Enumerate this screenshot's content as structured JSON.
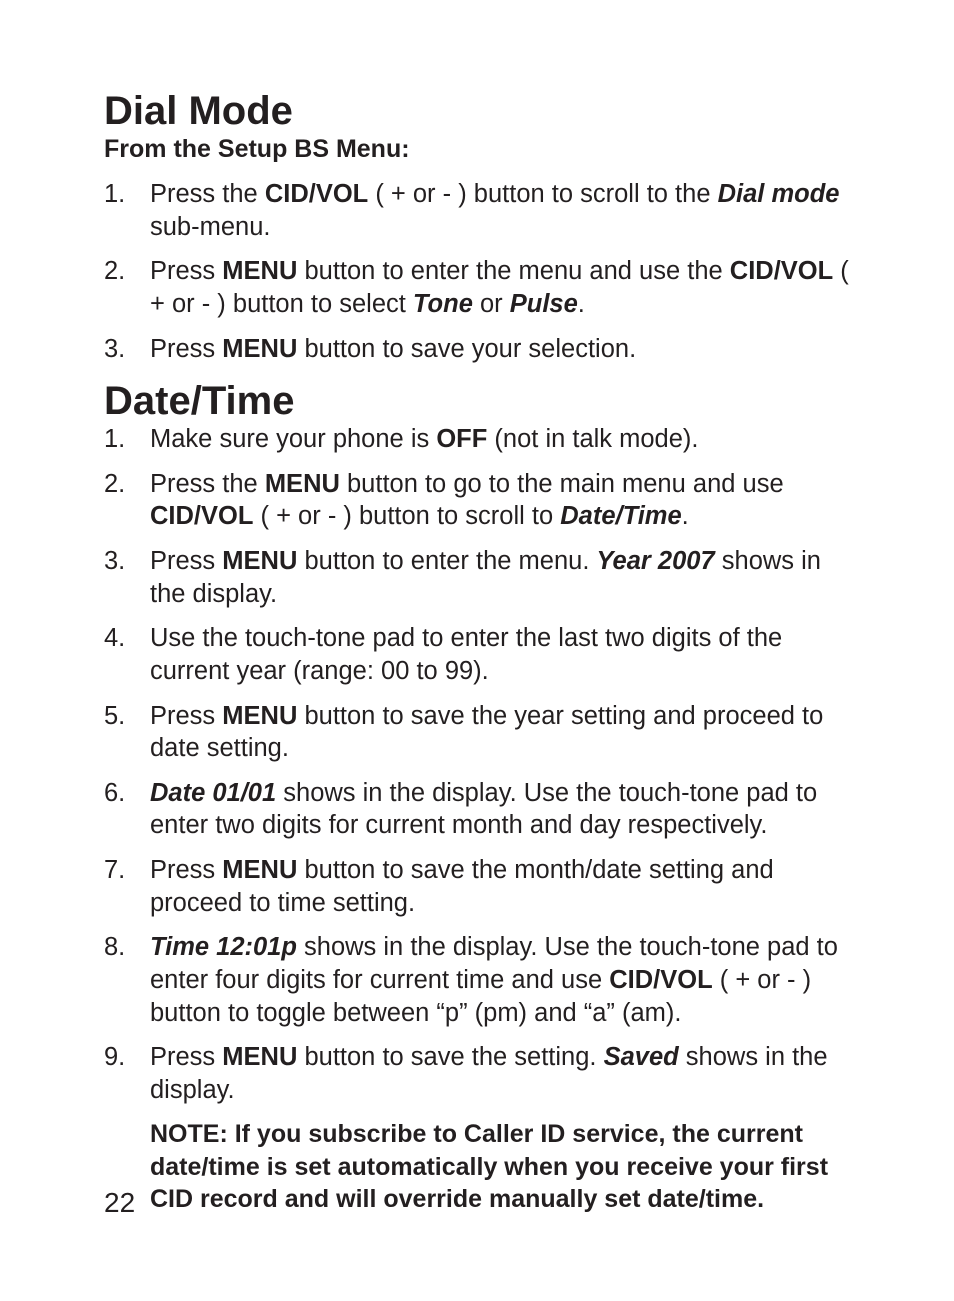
{
  "dialMode": {
    "heading": "Dial Mode",
    "subheading": "From the Setup BS Menu:",
    "steps": [
      {
        "num": "1.",
        "segments": [
          {
            "t": "Press the "
          },
          {
            "t": "CID/VOL",
            "b": true
          },
          {
            "t": " ( + or - ) button to scroll to the "
          },
          {
            "t": "Dial mode",
            "bi": true
          },
          {
            "t": " sub-menu."
          }
        ]
      },
      {
        "num": "2.",
        "segments": [
          {
            "t": "Press "
          },
          {
            "t": "MENU",
            "b": true
          },
          {
            "t": " button to enter the menu and use the "
          },
          {
            "t": "CID/VOL",
            "b": true
          },
          {
            "t": " ( + or - ) button to select "
          },
          {
            "t": "Tone",
            "bi": true
          },
          {
            "t": " or "
          },
          {
            "t": "Pulse",
            "bi": true
          },
          {
            "t": "."
          }
        ]
      },
      {
        "num": "3.",
        "segments": [
          {
            "t": "Press "
          },
          {
            "t": "MENU",
            "b": true
          },
          {
            "t": " button to save your selection."
          }
        ]
      }
    ]
  },
  "dateTime": {
    "heading": "Date/Time",
    "steps": [
      {
        "num": "1.",
        "segments": [
          {
            "t": "Make sure your phone is "
          },
          {
            "t": "OFF",
            "b": true
          },
          {
            "t": " (not in talk mode)."
          }
        ]
      },
      {
        "num": "2.",
        "segments": [
          {
            "t": "Press the "
          },
          {
            "t": "MENU",
            "b": true
          },
          {
            "t": " button to go to the main menu and use "
          },
          {
            "t": "CID/VOL",
            "b": true
          },
          {
            "t": " ( + or - ) button to scroll to "
          },
          {
            "t": "Date/Time",
            "bi": true
          },
          {
            "t": "."
          }
        ]
      },
      {
        "num": "3.",
        "segments": [
          {
            "t": "Press "
          },
          {
            "t": "MENU",
            "b": true
          },
          {
            "t": " button to enter the menu. "
          },
          {
            "t": "Year 2007",
            "bi": true
          },
          {
            "t": " shows in the display."
          }
        ]
      },
      {
        "num": "4.",
        "segments": [
          {
            "t": "Use the touch-tone pad to enter the last two digits of the current year (range: 00 to 99)."
          }
        ]
      },
      {
        "num": "5.",
        "segments": [
          {
            "t": "Press "
          },
          {
            "t": "MENU",
            "b": true
          },
          {
            "t": " button to save the year setting and proceed to date setting."
          }
        ]
      },
      {
        "num": "6.",
        "segments": [
          {
            "t": "Date 01/01",
            "bi": true
          },
          {
            "t": " shows in the display. Use the touch-tone pad to enter two digits for current month and day respectively."
          }
        ]
      },
      {
        "num": "7.",
        "segments": [
          {
            "t": "Press "
          },
          {
            "t": "MENU",
            "b": true
          },
          {
            "t": " button to save the month/date setting and proceed to time setting."
          }
        ]
      },
      {
        "num": "8.",
        "segments": [
          {
            "t": "Time 12:01p",
            "bi": true
          },
          {
            "t": " shows in the display. Use the touch-tone pad to enter four digits for current time and use "
          },
          {
            "t": "CID/VOL",
            "b": true
          },
          {
            "t": " ( + or - ) button to toggle between “p” (pm) and “a” (am)."
          }
        ]
      },
      {
        "num": "9.",
        "segments": [
          {
            "t": "Press "
          },
          {
            "t": "MENU",
            "b": true
          },
          {
            "t": " button to save the setting. "
          },
          {
            "t": "Saved",
            "bi": true
          },
          {
            "t": " shows in the display."
          }
        ]
      }
    ],
    "note": "NOTE: If you subscribe to Caller ID service, the current date/time is set automatically when you receive your first CID record and will override manually set date/time."
  },
  "pageNumber": "22"
}
